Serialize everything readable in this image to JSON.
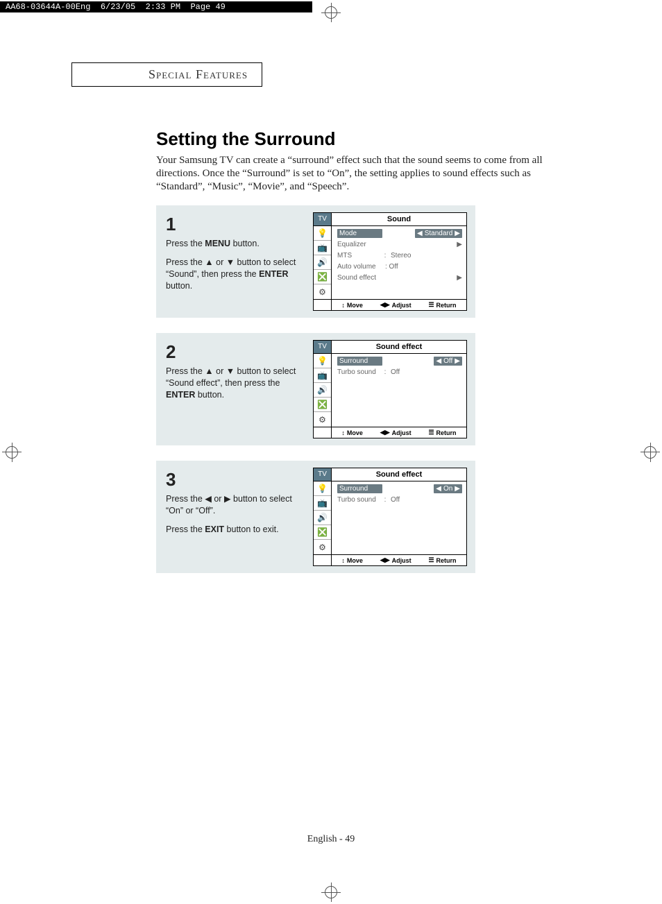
{
  "file_header": "AA68-03644A-00Eng  6/23/05  2:33 PM  Page 49",
  "section_tab": "Special Features",
  "title": "Setting the Surround",
  "intro": "Your Samsung TV can create a “surround” effect such that the sound seems to come from all directions. Once the “Surround” is set to “On”, the setting applies to sound effects such as “Standard”, “Music”, “Movie”, and “Speech”.",
  "steps": [
    {
      "num": "1",
      "paras": [
        {
          "pre": "Press the ",
          "bold": "MENU",
          "post": " button."
        },
        {
          "pre": "Press the ▲ or ▼ button to select “Sound”, then press the ",
          "bold": "ENTER",
          "post": " button."
        }
      ],
      "menu_title": "Sound",
      "rows": [
        {
          "label": "Mode",
          "value": "Standard",
          "selected": true,
          "arrows": "lr"
        },
        {
          "label": "Equalizer",
          "value": "",
          "arrows": "r"
        },
        {
          "label": "MTS",
          "colon": ":",
          "value": "Stereo"
        },
        {
          "label": "Auto volume",
          "value": ": Off"
        },
        {
          "label": "Sound effect",
          "value": "",
          "arrows": "r"
        }
      ]
    },
    {
      "num": "2",
      "paras": [
        {
          "pre": "Press the ▲ or ▼ button to select “Sound effect”, then press the ",
          "bold": "ENTER",
          "post": " button."
        }
      ],
      "menu_title": "Sound effect",
      "rows": [
        {
          "label": "Surround",
          "value": "Off",
          "selected": true,
          "arrows": "lr"
        },
        {
          "label": "Turbo sound",
          "colon": ":",
          "value": "Off"
        }
      ]
    },
    {
      "num": "3",
      "paras": [
        {
          "pre": "Press the ◀ or ▶ button to select “On” or “Off”.",
          "bold": "",
          "post": ""
        },
        {
          "pre": "Press the ",
          "bold": "EXIT",
          "post": " button to exit."
        }
      ],
      "menu_title": "Sound effect",
      "rows": [
        {
          "label": "Surround",
          "value": "On",
          "selected": true,
          "arrows": "lr"
        },
        {
          "label": "Turbo sound",
          "colon": ":",
          "value": "Off"
        }
      ]
    }
  ],
  "tv_label": "TV",
  "icons": [
    "💡",
    "📺",
    "🔊",
    "❎",
    "⚙"
  ],
  "footer": {
    "move": "Move",
    "adjust": "Adjust",
    "return": "Return"
  },
  "footer_icons": {
    "move": "↕",
    "adjust": "◀▶",
    "return": "☰"
  },
  "pager": "English - 49"
}
